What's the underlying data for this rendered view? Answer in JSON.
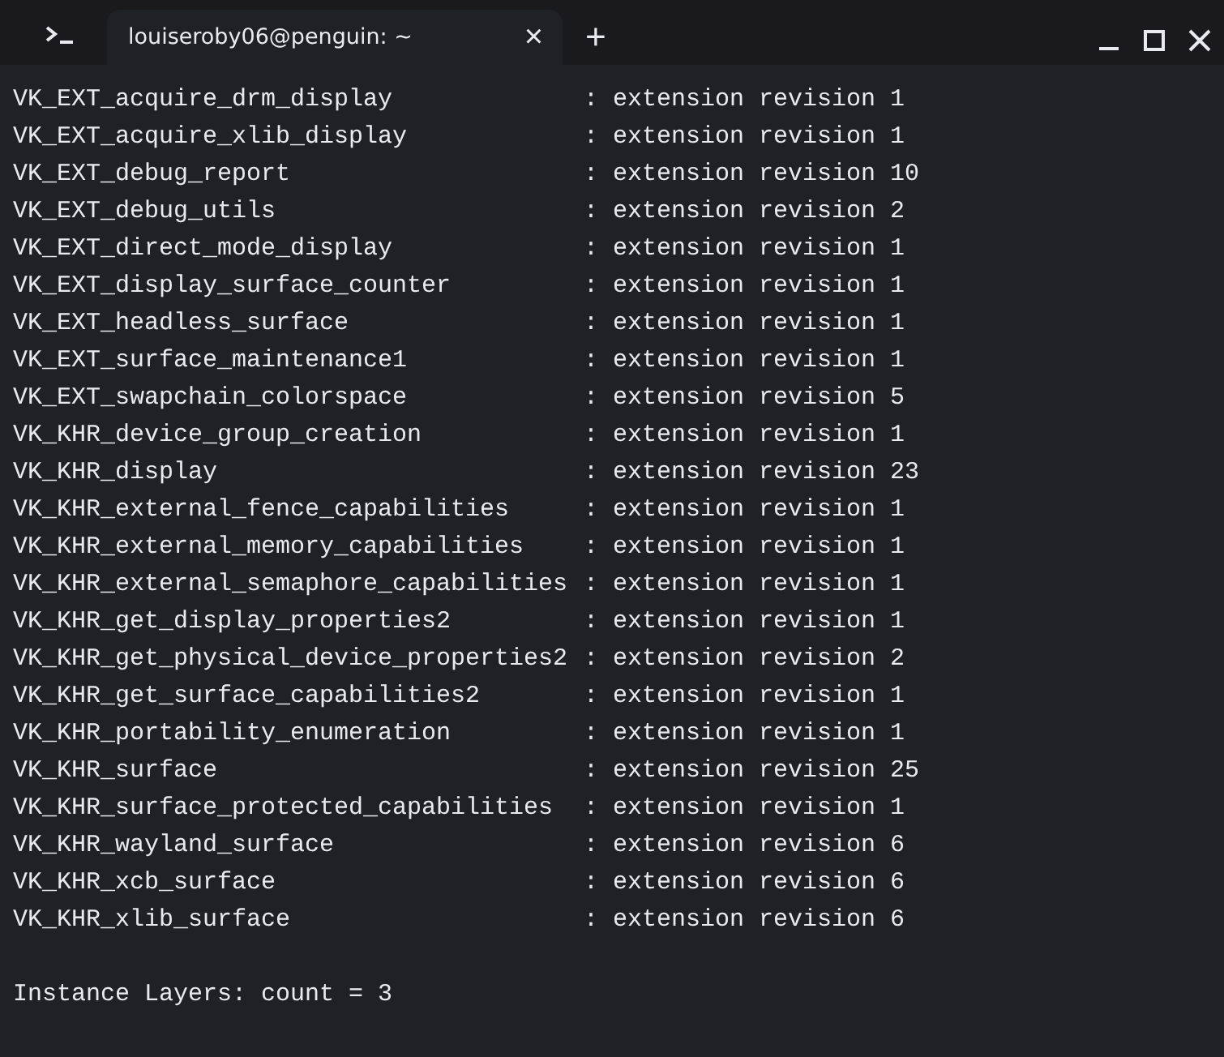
{
  "window": {
    "tab_title": "louiseroby06@penguin: ~",
    "tab_close": "×",
    "new_tab": "+"
  },
  "terminal": {
    "lines": [
      {
        "name": "VK_EXT_acquire_drm_display",
        "info": ": extension revision 1"
      },
      {
        "name": "VK_EXT_acquire_xlib_display",
        "info": ": extension revision 1"
      },
      {
        "name": "VK_EXT_debug_report",
        "info": ": extension revision 10"
      },
      {
        "name": "VK_EXT_debug_utils",
        "info": ": extension revision 2"
      },
      {
        "name": "VK_EXT_direct_mode_display",
        "info": ": extension revision 1"
      },
      {
        "name": "VK_EXT_display_surface_counter",
        "info": ": extension revision 1"
      },
      {
        "name": "VK_EXT_headless_surface",
        "info": ": extension revision 1"
      },
      {
        "name": "VK_EXT_surface_maintenance1",
        "info": ": extension revision 1"
      },
      {
        "name": "VK_EXT_swapchain_colorspace",
        "info": ": extension revision 5"
      },
      {
        "name": "VK_KHR_device_group_creation",
        "info": ": extension revision 1"
      },
      {
        "name": "VK_KHR_display",
        "info": ": extension revision 23"
      },
      {
        "name": "VK_KHR_external_fence_capabilities",
        "info": ": extension revision 1"
      },
      {
        "name": "VK_KHR_external_memory_capabilities",
        "info": ": extension revision 1"
      },
      {
        "name": "VK_KHR_external_semaphore_capabilities",
        "info": ": extension revision 1"
      },
      {
        "name": "VK_KHR_get_display_properties2",
        "info": ": extension revision 1"
      },
      {
        "name": "VK_KHR_get_physical_device_properties2",
        "info": ": extension revision 2"
      },
      {
        "name": "VK_KHR_get_surface_capabilities2",
        "info": ": extension revision 1"
      },
      {
        "name": "VK_KHR_portability_enumeration",
        "info": ": extension revision 1"
      },
      {
        "name": "VK_KHR_surface",
        "info": ": extension revision 25"
      },
      {
        "name": "VK_KHR_surface_protected_capabilities",
        "info": ": extension revision 1"
      },
      {
        "name": "VK_KHR_wayland_surface",
        "info": ": extension revision 6"
      },
      {
        "name": "VK_KHR_xcb_surface",
        "info": ": extension revision 6"
      },
      {
        "name": "VK_KHR_xlib_surface",
        "info": ": extension revision 6"
      }
    ],
    "footer": "Instance Layers: count = 3"
  }
}
